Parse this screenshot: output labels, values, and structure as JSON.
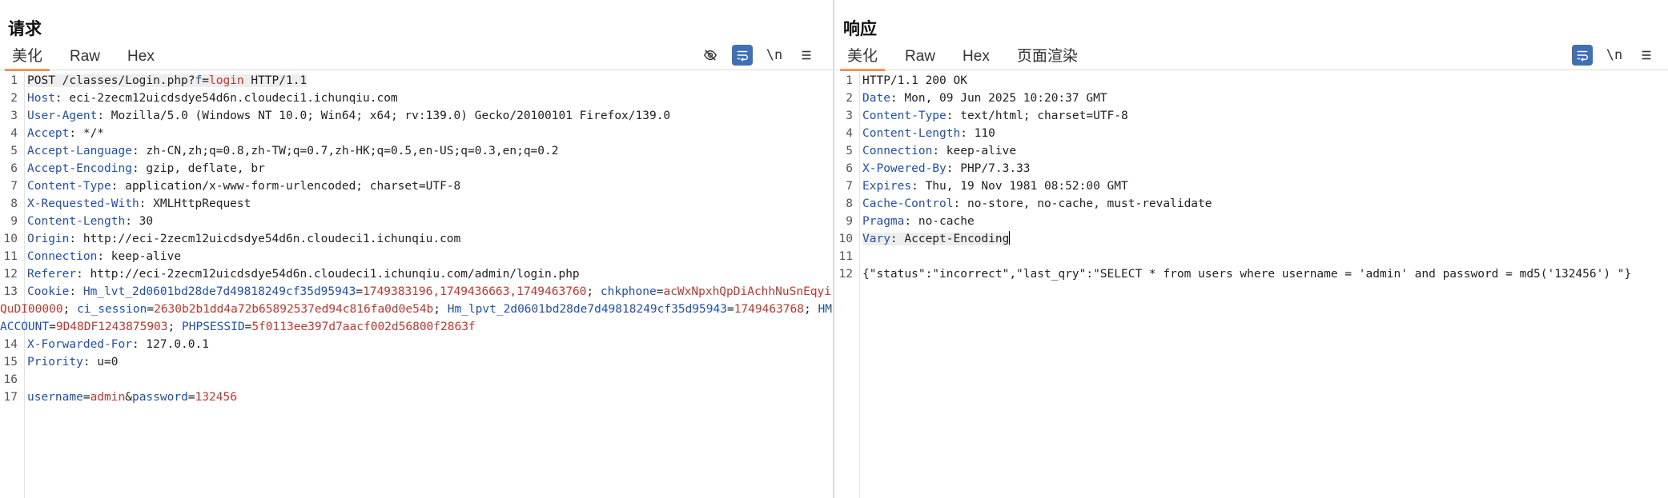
{
  "request": {
    "title": "请求",
    "tabs": [
      "美化",
      "Raw",
      "Hex"
    ],
    "active_tab": 0,
    "toolbar_newline": "\\n",
    "lines": [
      {
        "n": "1",
        "parts": [
          [
            "v",
            "POST /classes/Login.php?"
          ],
          [
            "k",
            "f"
          ],
          [
            "v",
            "="
          ],
          [
            "s",
            "login"
          ],
          [
            "v",
            " HTTP/1.1"
          ]
        ]
      },
      {
        "n": "2",
        "parts": [
          [
            "k",
            "Host"
          ],
          [
            "v",
            ": eci-2zecm12uicdsdye54d6n.cloudeci1.ichunqiu.com"
          ]
        ]
      },
      {
        "n": "3",
        "parts": [
          [
            "k",
            "User-Agent"
          ],
          [
            "v",
            ": Mozilla/5.0 (Windows NT 10.0; Win64; x64; rv:139.0) Gecko/20100101 Firefox/139.0"
          ]
        ]
      },
      {
        "n": "4",
        "parts": [
          [
            "k",
            "Accept"
          ],
          [
            "v",
            ": */*"
          ]
        ]
      },
      {
        "n": "5",
        "parts": [
          [
            "k",
            "Accept-Language"
          ],
          [
            "v",
            ": zh-CN,zh;q=0.8,zh-TW;q=0.7,zh-HK;q=0.5,en-US;q=0.3,en;q=0.2"
          ]
        ]
      },
      {
        "n": "6",
        "parts": [
          [
            "k",
            "Accept-Encoding"
          ],
          [
            "v",
            ": gzip, deflate, br"
          ]
        ]
      },
      {
        "n": "7",
        "parts": [
          [
            "k",
            "Content-Type"
          ],
          [
            "v",
            ": application/x-www-form-urlencoded; charset=UTF-8"
          ]
        ]
      },
      {
        "n": "8",
        "parts": [
          [
            "k",
            "X-Requested-With"
          ],
          [
            "v",
            ": XMLHttpRequest"
          ]
        ]
      },
      {
        "n": "9",
        "parts": [
          [
            "k",
            "Content-Length"
          ],
          [
            "v",
            ": 30"
          ]
        ]
      },
      {
        "n": "10",
        "parts": [
          [
            "k",
            "Origin"
          ],
          [
            "v",
            ": http://eci-2zecm12uicdsdye54d6n.cloudeci1.ichunqiu.com"
          ]
        ]
      },
      {
        "n": "11",
        "parts": [
          [
            "k",
            "Connection"
          ],
          [
            "v",
            ": keep-alive"
          ]
        ]
      },
      {
        "n": "12",
        "parts": [
          [
            "k",
            "Referer"
          ],
          [
            "v",
            ": http://eci-2zecm12uicdsdye54d6n.cloudeci1.ichunqiu.com/admin/login.php"
          ]
        ]
      },
      {
        "n": "13",
        "parts": [
          [
            "k",
            "Cookie"
          ],
          [
            "v",
            ": "
          ],
          [
            "k",
            "Hm_lvt_2d0601bd28de7d49818249cf35d95943"
          ],
          [
            "v",
            "="
          ],
          [
            "s",
            "1749383196,1749436663,1749463760"
          ],
          [
            "v",
            "; "
          ],
          [
            "k",
            "chkphone"
          ],
          [
            "v",
            "="
          ],
          [
            "s",
            "acWxNpxhQpDiAchhNuSnEqyiQuDI00000"
          ],
          [
            "v",
            "; "
          ],
          [
            "k",
            "ci_session"
          ],
          [
            "v",
            "="
          ],
          [
            "s",
            "2630b2b1dd4a72b65892537ed94c816fa0d0e54b"
          ],
          [
            "v",
            "; "
          ],
          [
            "k",
            "Hm_lpvt_2d0601bd28de7d49818249cf35d95943"
          ],
          [
            "v",
            "="
          ],
          [
            "s",
            "1749463768"
          ],
          [
            "v",
            "; "
          ],
          [
            "k",
            "HMACCOUNT"
          ],
          [
            "v",
            "="
          ],
          [
            "s",
            "9D48DF1243875903"
          ],
          [
            "v",
            "; "
          ],
          [
            "k",
            "PHPSESSID"
          ],
          [
            "v",
            "="
          ],
          [
            "s",
            "5f0113ee397d7aacf002d56800f2863f"
          ]
        ]
      },
      {
        "n": "14",
        "parts": [
          [
            "k",
            "X-Forwarded-For"
          ],
          [
            "v",
            ": 127.0.0.1"
          ]
        ]
      },
      {
        "n": "15",
        "parts": [
          [
            "k",
            "Priority"
          ],
          [
            "v",
            ": u=0"
          ]
        ]
      },
      {
        "n": "16",
        "parts": []
      },
      {
        "n": "17",
        "parts": [
          [
            "k",
            "username"
          ],
          [
            "v",
            "="
          ],
          [
            "s",
            "admin"
          ],
          [
            "v",
            "&"
          ],
          [
            "k",
            "password"
          ],
          [
            "v",
            "="
          ],
          [
            "s",
            "132456"
          ]
        ]
      }
    ]
  },
  "response": {
    "title": "响应",
    "tabs": [
      "美化",
      "Raw",
      "Hex",
      "页面渲染"
    ],
    "active_tab": 0,
    "toolbar_newline": "\\n",
    "lines": [
      {
        "n": "1",
        "parts": [
          [
            "v",
            "HTTP/1.1 200 OK"
          ]
        ]
      },
      {
        "n": "2",
        "parts": [
          [
            "k",
            "Date"
          ],
          [
            "v",
            ": Mon, 09 Jun 2025 10:20:37 GMT"
          ]
        ]
      },
      {
        "n": "3",
        "parts": [
          [
            "k",
            "Content-Type"
          ],
          [
            "v",
            ": text/html; charset=UTF-8"
          ]
        ]
      },
      {
        "n": "4",
        "parts": [
          [
            "k",
            "Content-Length"
          ],
          [
            "v",
            ": 110"
          ]
        ]
      },
      {
        "n": "5",
        "parts": [
          [
            "k",
            "Connection"
          ],
          [
            "v",
            ": keep-alive"
          ]
        ]
      },
      {
        "n": "6",
        "parts": [
          [
            "k",
            "X-Powered-By"
          ],
          [
            "v",
            ": PHP/7.3.33"
          ]
        ]
      },
      {
        "n": "7",
        "parts": [
          [
            "k",
            "Expires"
          ],
          [
            "v",
            ": Thu, 19 Nov 1981 08:52:00 GMT"
          ]
        ]
      },
      {
        "n": "8",
        "parts": [
          [
            "k",
            "Cache-Control"
          ],
          [
            "v",
            ": no-store, no-cache, must-revalidate"
          ]
        ]
      },
      {
        "n": "9",
        "parts": [
          [
            "k",
            "Pragma"
          ],
          [
            "v",
            ": no-cache"
          ]
        ]
      },
      {
        "n": "10",
        "parts": [
          [
            "k",
            "Vary"
          ],
          [
            "v",
            ": Accept-Encoding"
          ]
        ]
      },
      {
        "n": "11",
        "parts": []
      },
      {
        "n": "12",
        "parts": [
          [
            "v",
            "{\"status\":\"incorrect\",\"last_qry\":\"SELECT * from users where username = 'admin' and password = md5('132456') \"}"
          ]
        ]
      }
    ]
  }
}
